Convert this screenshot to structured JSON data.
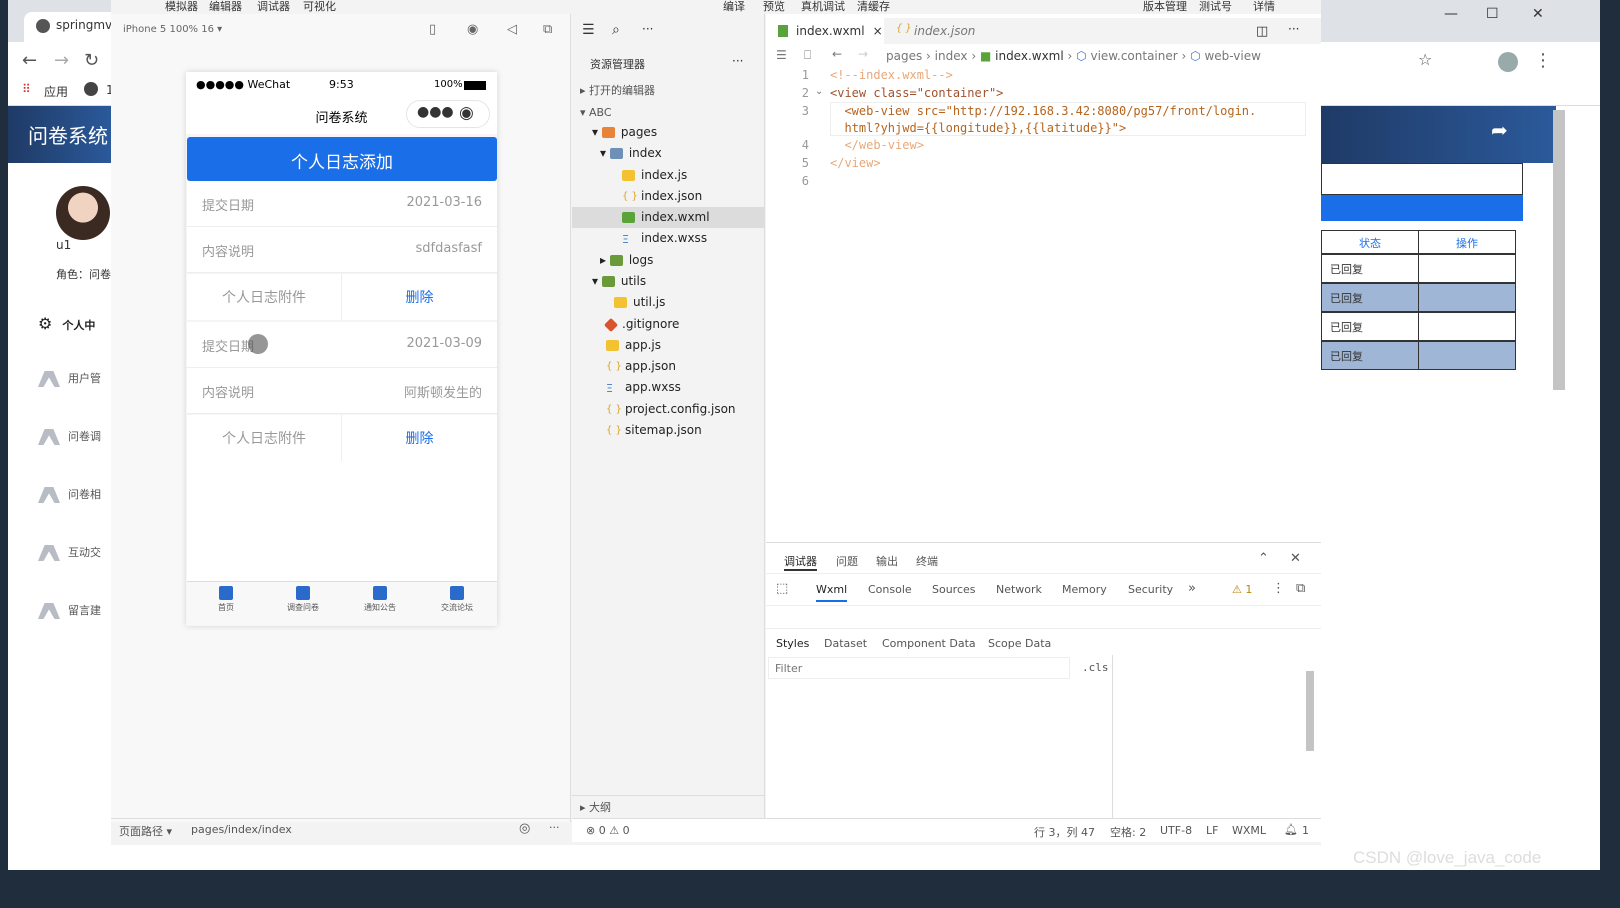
{
  "browser": {
    "tab_title": "springmvc",
    "bookmarks_apps": "应用",
    "bookmarks_more": "1"
  },
  "site": {
    "logo": "问卷系统",
    "username": "u1",
    "role": "角色：问卷",
    "menu": [
      "个人中",
      "用户管",
      "问卷调",
      "问卷相",
      "互动交",
      "留言建"
    ],
    "right_table": {
      "headers": [
        "状态",
        "操作"
      ],
      "rows": [
        "已回复",
        "已回复",
        "已回复",
        "已回复"
      ]
    }
  },
  "devtools": {
    "menu": [
      "模拟器",
      "编辑器",
      "调试器",
      "可视化",
      "编译",
      "预览",
      "真机调试",
      "清缓存",
      "版本管理",
      "测试号",
      "详情"
    ],
    "sim_device": "iPhone 5 100% 16 ▾",
    "phone": {
      "carrier": "●●●●● WeChat",
      "time": "9:53",
      "battery": "100%",
      "nav_title": "问卷系统",
      "add_button": "个人日志添加",
      "records": [
        {
          "date_label": "提交日期",
          "date": "2021-03-16",
          "desc_label": "内容说明",
          "desc": "sdfdasfasf",
          "attach": "个人日志附件",
          "delete": "删除"
        },
        {
          "date_label": "提交日期",
          "date": "2021-03-09",
          "desc_label": "内容说明",
          "desc": "阿斯顿发生的",
          "attach": "个人日志附件",
          "delete": "删除"
        }
      ],
      "tabs": [
        "首页",
        "调查问卷",
        "通知公告",
        "交流论坛"
      ]
    },
    "sim_footer": {
      "label": "页面路径 ▾",
      "path": "pages/index/index"
    },
    "explorer": {
      "title": "资源管理器",
      "open_editors": "打开的编辑器",
      "project": "ABC",
      "tree": [
        "pages",
        "index",
        "index.js",
        "index.json",
        "index.wxml",
        "index.wxss",
        "logs",
        "utils",
        "util.js",
        ".gitignore",
        "app.js",
        "app.json",
        "app.wxss",
        "project.config.json",
        "sitemap.json"
      ],
      "outline": "大纲",
      "errors": "⊗ 0 ⚠ 0"
    },
    "editor": {
      "tabs": [
        "index.wxml",
        "index.json"
      ],
      "breadcrumb": [
        "pages",
        "index",
        "index.wxml",
        "view.container",
        "web-view"
      ],
      "line_numbers": [
        "1",
        "2",
        "3",
        "",
        "4",
        "5",
        "6"
      ],
      "code": [
        "<!--index.wxml-->",
        "<view class=\"container\">",
        "  <web-view src=\"http://192.168.3.42:8080/pg57/front/login.",
        "  html?yhjwd={{longitude}},{{latitude}}\">",
        "  </web-view>",
        "</view>",
        ""
      ]
    },
    "debugger": {
      "top_tabs": [
        "调试器",
        "问题",
        "输出",
        "终端"
      ],
      "panel_tabs": [
        "Wxml",
        "Console",
        "Sources",
        "Network",
        "Memory",
        "Security",
        "»"
      ],
      "warning": "⚠ 1",
      "style_tabs": [
        "Styles",
        "Dataset",
        "Component Data",
        "Scope Data"
      ],
      "filter_placeholder": "Filter",
      "cls": ".cls"
    },
    "status": {
      "position": "行 3，列 47",
      "spaces": "空格: 2",
      "encoding": "UTF-8",
      "eol": "LF",
      "lang": "WXML",
      "bell": "1"
    }
  },
  "watermark": "CSDN @love_java_code",
  "colors": {
    "primary": "#1a6ee8",
    "site_header": "#2b5a9b"
  }
}
